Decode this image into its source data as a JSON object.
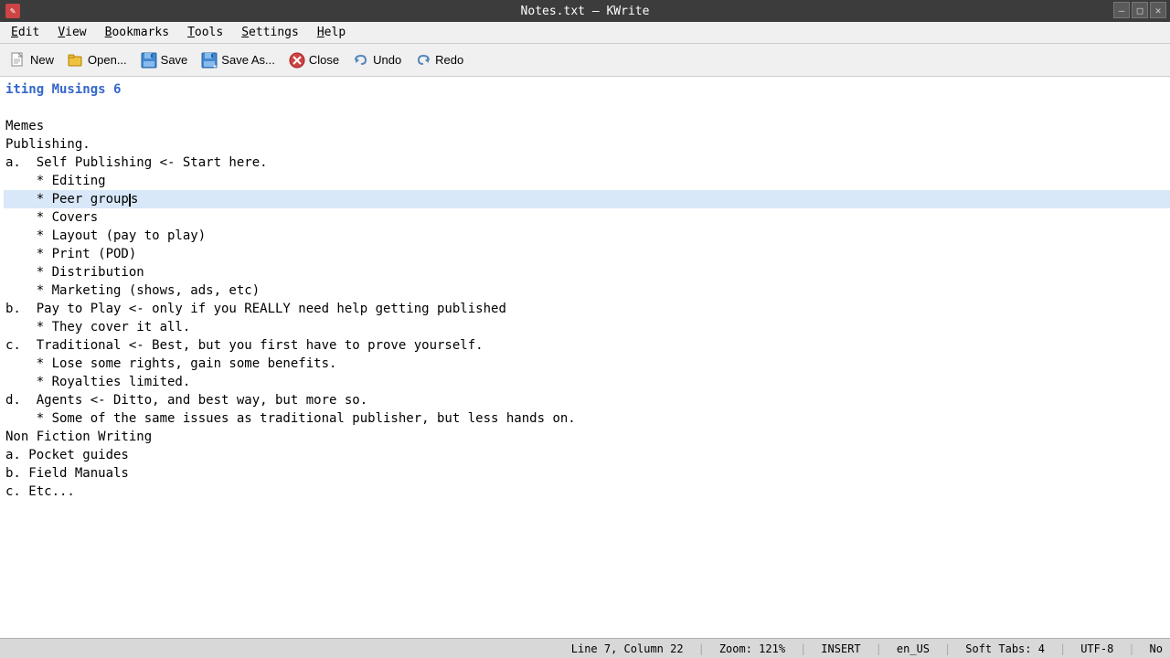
{
  "titlebar": {
    "title": "Notes.txt — KWrite",
    "window_icon": "✎"
  },
  "window_controls": {
    "minimize": "—",
    "maximize": "□",
    "close": "✕"
  },
  "menu": {
    "items": [
      {
        "label": "Edit",
        "underline_index": 0
      },
      {
        "label": "View",
        "underline_index": 0
      },
      {
        "label": "Bookmarks",
        "underline_index": 0
      },
      {
        "label": "Tools",
        "underline_index": 0
      },
      {
        "label": "Settings",
        "underline_index": 0
      },
      {
        "label": "Help",
        "underline_index": 0
      }
    ]
  },
  "toolbar": {
    "new_label": "New",
    "open_label": "Open...",
    "save_label": "Save",
    "saveas_label": "Save As...",
    "close_label": "Close",
    "undo_label": "Undo",
    "redo_label": "Redo"
  },
  "editor": {
    "partial_header": "iting Musings 6",
    "lines": [
      "",
      "Memes",
      "Publishing.",
      "a.  Self Publishing <- Start here.",
      "    * Editing",
      "    * Peer groups",
      "    * Covers",
      "    * Layout (pay to play)",
      "    * Print (POD)",
      "    * Distribution",
      "    * Marketing (shows, ads, etc)",
      "b.  Pay to Play <- only if you REALLY need help getting published",
      "    * They cover it all.",
      "c.  Traditional <- Best, but you first have to prove yourself.",
      "    * Lose some rights, gain some benefits.",
      "    * Royalties limited.",
      "d.  Agents <- Ditto, and best way, but more so.",
      "    * Some of the same issues as traditional publisher, but less hands on.",
      "Non Fiction Writing",
      "a. Pocket guides",
      "b. Field Manuals",
      "c. Etc...",
      ""
    ],
    "active_line_index": 5,
    "cursor_col_in_active": 16
  },
  "statusbar": {
    "line": "Line 7, Column 22",
    "zoom": "Zoom: 121%",
    "mode": "INSERT",
    "locale": "en_US",
    "tab_info": "Soft Tabs: 4",
    "encoding": "UTF-8",
    "extra": "No"
  }
}
